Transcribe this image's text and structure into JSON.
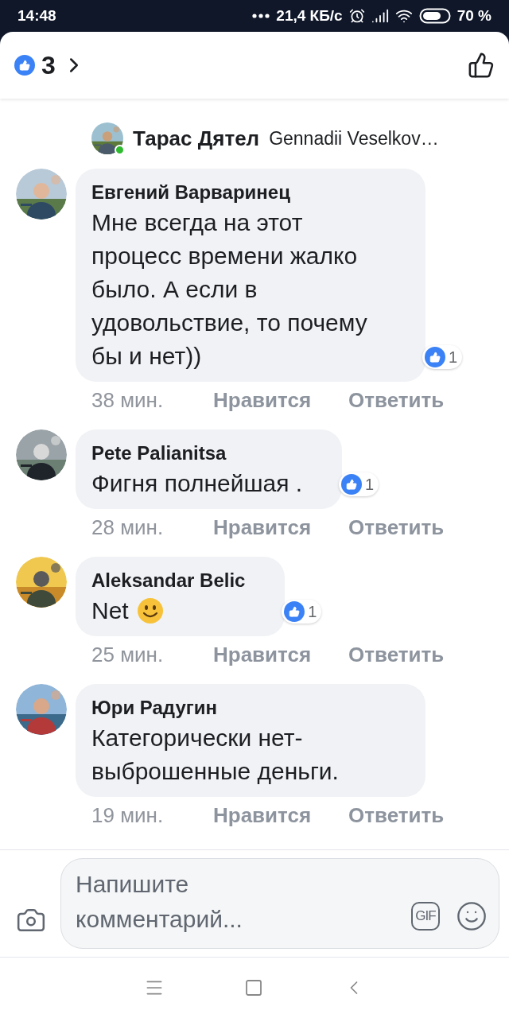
{
  "status_bar": {
    "time": "14:48",
    "network_speed": "21,4 КБ/с",
    "battery": "70 %"
  },
  "header": {
    "reaction_count": "3"
  },
  "reply_preview": {
    "author": "Тарас Дятел",
    "text": "Gennadii Veselkov…",
    "online": true
  },
  "comments": [
    {
      "kind": "text",
      "author": "Евгений Варваринец",
      "text": "Мне всегда на этот процесс времени жалко было. А если в удовольствие, то почему бы и нет))",
      "reaction_count": "1",
      "time": "38 мин.",
      "like_label": "Нравится",
      "reply_label": "Ответить"
    },
    {
      "kind": "text",
      "author": "Pete Palianitsa",
      "text": "Фигня полнейшая .",
      "reaction_count": "1",
      "time": "28 мин.",
      "like_label": "Нравится",
      "reply_label": "Ответить"
    },
    {
      "author": "Aleksandar Belic",
      "text": "Net",
      "kind": "emoji",
      "reaction_count": "1",
      "time": "25 мин.",
      "like_label": "Нравится",
      "reply_label": "Ответить"
    },
    {
      "kind": "text",
      "author": "Юри Радугин",
      "text": "Категорически нет-выброшенные деньги.",
      "time": "19 мин.",
      "like_label": "Нравится",
      "reply_label": "Ответить"
    }
  ],
  "composer": {
    "placeholder": "Напишите комментарий...",
    "gif_label": "GIF"
  }
}
